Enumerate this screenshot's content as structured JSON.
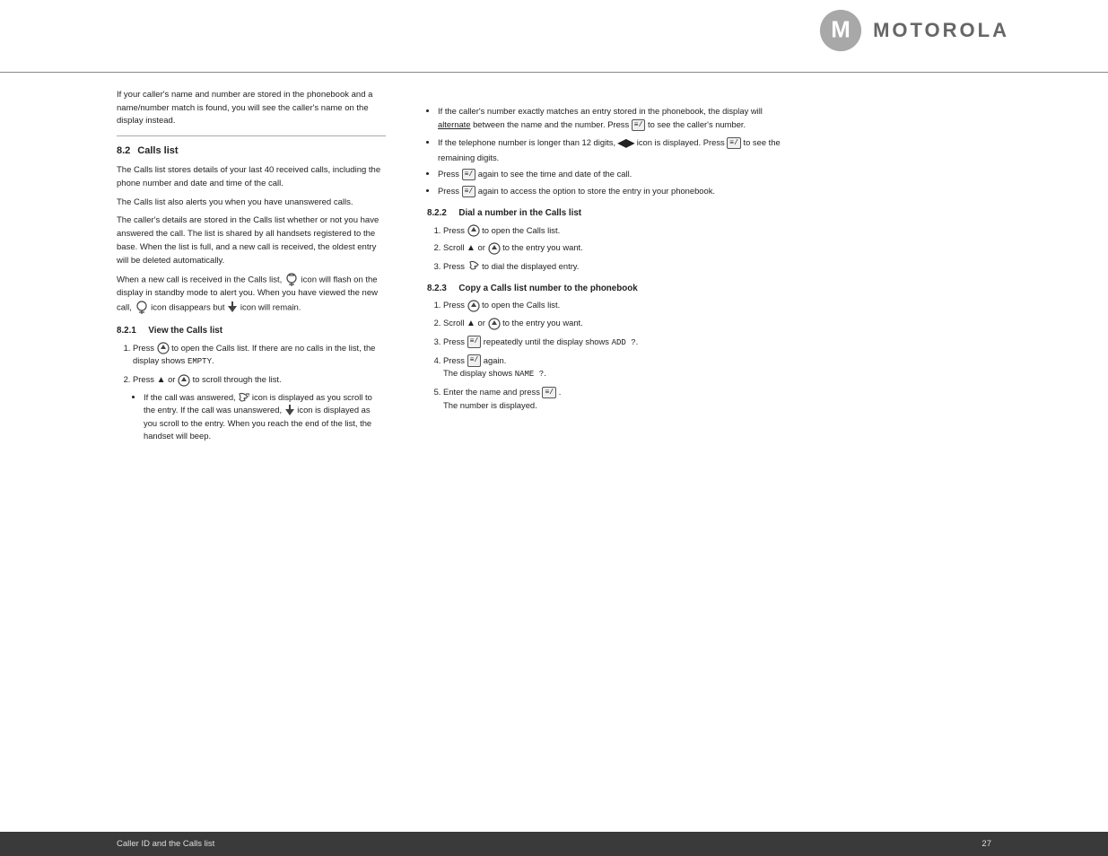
{
  "page": {
    "footer": {
      "left_label": "Caller ID and the Calls list",
      "page_number": "27"
    },
    "logo": {
      "brand": "MOTOROLA"
    },
    "intro_text": "If your caller's name and number are stored in the phonebook and a name/number match is found, you will see the caller's name on the display instead.",
    "section_8_2": {
      "number": "8.2",
      "title": "Calls list",
      "para1": "The Calls list stores details of your last 40 received calls, including the phone number and date and time of the call.",
      "para2": "The Calls list also alerts you when you have unanswered calls.",
      "para3": "The caller's details are stored in the Calls list whether or not you have answered the call. The list is shared by all handsets registered to the base. When the list is full, and a new call is received, the oldest entry will be deleted automatically.",
      "para4": "When a new call is received in the Calls list, icon will flash on the display in standby mode to alert you. When you have viewed the new call, icon disappears but icon will remain.",
      "subsection_8_2_1": {
        "number": "8.2.1",
        "title": "View the Calls list",
        "steps": [
          "Press to open the Calls list. If there are no calls in the list, the display shows EMPTY.",
          "Press or to scroll through the list."
        ],
        "bullets": [
          "If the call was answered, icon is displayed as you scroll to the entry. If the call was unanswered, icon is displayed as you scroll to the entry. When you reach the end of the list, the handset will beep."
        ]
      }
    },
    "right_column": {
      "bullets_top": [
        "If the caller's number exactly matches an entry stored in the phonebook, the display will alternate between the name and the number. Press to see the caller's number.",
        "If the telephone number is longer than 12 digits, icon is displayed. Press to see the remaining digits.",
        "Press again to see the time and date of the call.",
        "Press again to access the option to store the entry in your phonebook."
      ],
      "subsection_8_2_2": {
        "number": "8.2.2",
        "title": "Dial a number in the Calls list",
        "steps": [
          "Press to open the Calls list.",
          "Scroll or to the entry you want.",
          "Press to dial the displayed entry."
        ]
      },
      "subsection_8_2_3": {
        "number": "8.2.3",
        "title": "Copy a Calls list number to the phonebook",
        "steps": [
          "Press to open the Calls list.",
          "Scroll or to the entry you want.",
          "Press repeatedly until the display shows ADD ?.",
          "Press again. The display shows NAME ?.",
          "Enter the name and press . The number is displayed."
        ]
      }
    }
  }
}
